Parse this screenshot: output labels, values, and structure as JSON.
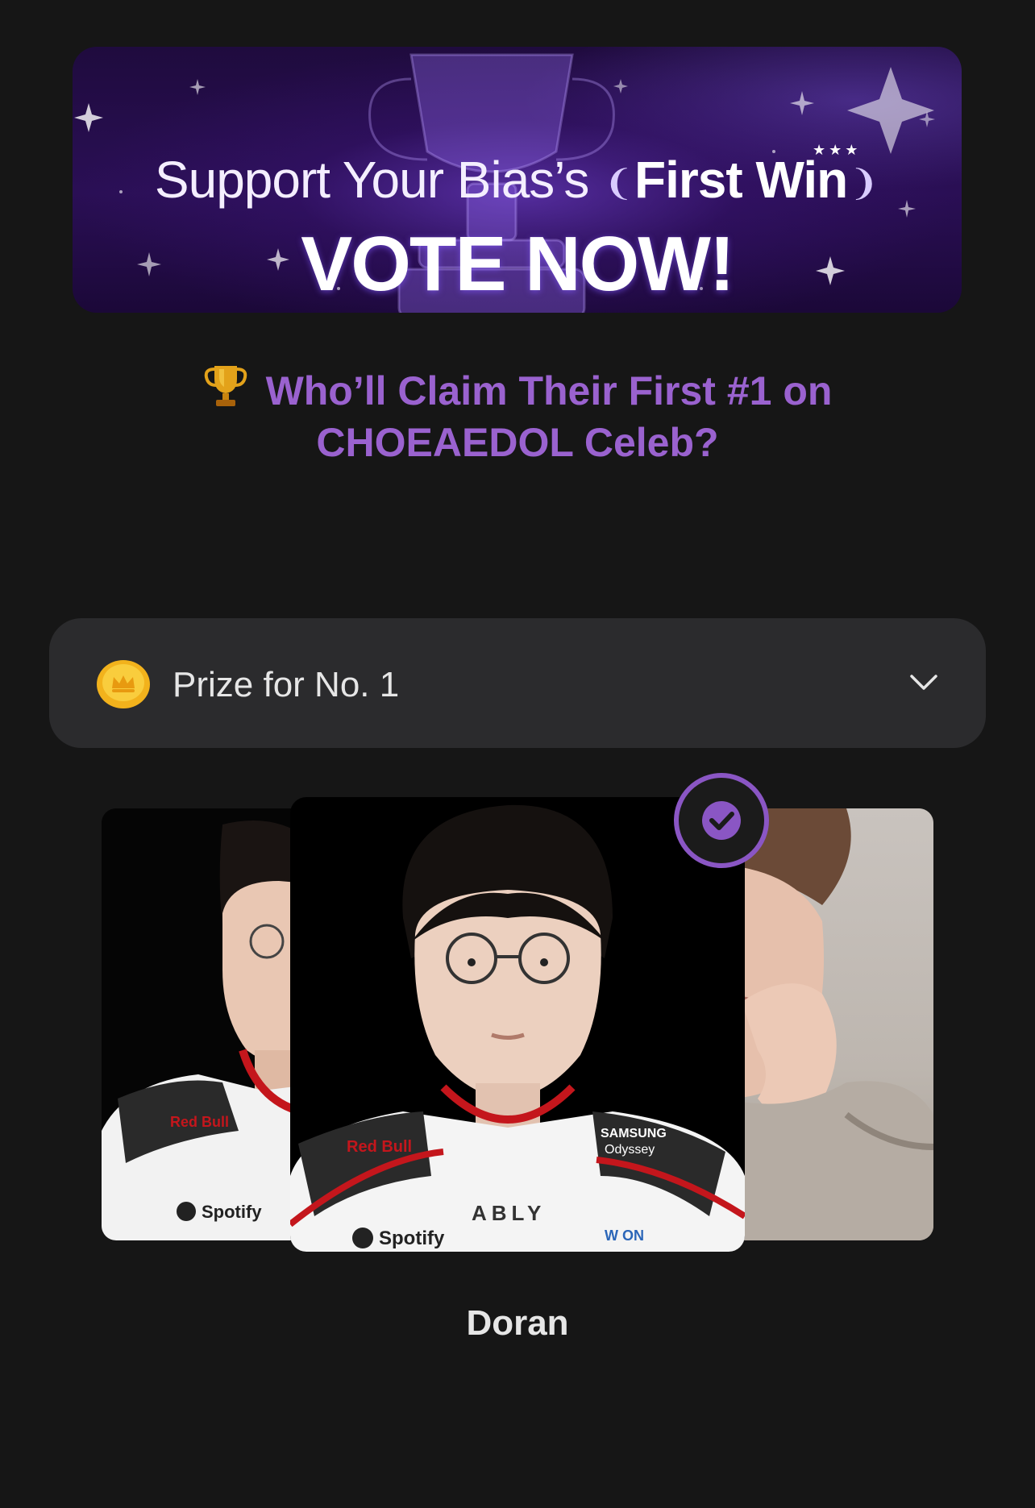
{
  "banner": {
    "line1_part1": "Support Your Bias’s",
    "line1_highlight": "First Win",
    "line2": "VOTE NOW!"
  },
  "headline": {
    "icon": "trophy-icon",
    "text": "Who’ll Claim Their First #1 on CHOEAEDOL Celeb?"
  },
  "prize": {
    "icon": "coin-icon",
    "label": "Prize for No. 1",
    "toggle_icon": "chevron-down-icon"
  },
  "carousel": {
    "selected_index": 1,
    "selected_name": "Doran",
    "selected_badge_icon": "check-circle-icon",
    "jersey_texts": {
      "sponsor_1": "Red Bull",
      "sponsor_2": "Spotify",
      "sponsor_3": "ABLY",
      "sponsor_4": "SAMSUNG",
      "sponsor_4b": "Odyssey",
      "sponsor_5": "W ON"
    }
  },
  "colors": {
    "background": "#161616",
    "accent_purple": "#9a62cf",
    "card_surface": "#2b2b2d",
    "check_badge": "#8a56c4"
  }
}
